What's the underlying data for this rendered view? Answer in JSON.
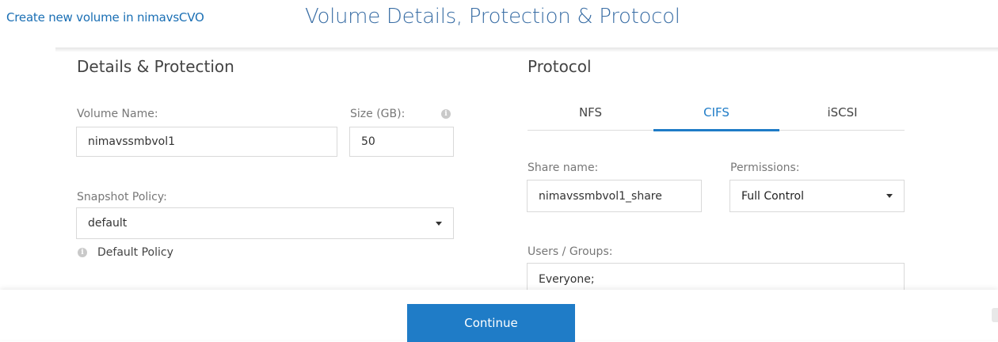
{
  "header": {
    "breadcrumb_link": "Create new volume in nimavsCVO",
    "title": "Volume Details, Protection & Protocol"
  },
  "details": {
    "section_title": "Details & Protection",
    "volume_name_label": "Volume Name:",
    "volume_name_value": "nimavssmbvol1",
    "size_label": "Size (GB):",
    "size_value": "50",
    "snapshot_policy_label": "Snapshot Policy:",
    "snapshot_policy_value": "default",
    "snapshot_policy_hint": "Default Policy"
  },
  "protocol": {
    "section_title": "Protocol",
    "tabs": [
      {
        "label": "NFS",
        "active": false
      },
      {
        "label": "CIFS",
        "active": true
      },
      {
        "label": "iSCSI",
        "active": false
      }
    ],
    "share_name_label": "Share name:",
    "share_name_value": "nimavssmbvol1_share",
    "permissions_label": "Permissions:",
    "permissions_value": "Full Control",
    "users_groups_label": "Users / Groups:",
    "users_groups_value": "Everyone;"
  },
  "footer": {
    "continue_label": "Continue"
  },
  "colors": {
    "accent": "#1f7cc7",
    "title": "#3a6ea5"
  }
}
